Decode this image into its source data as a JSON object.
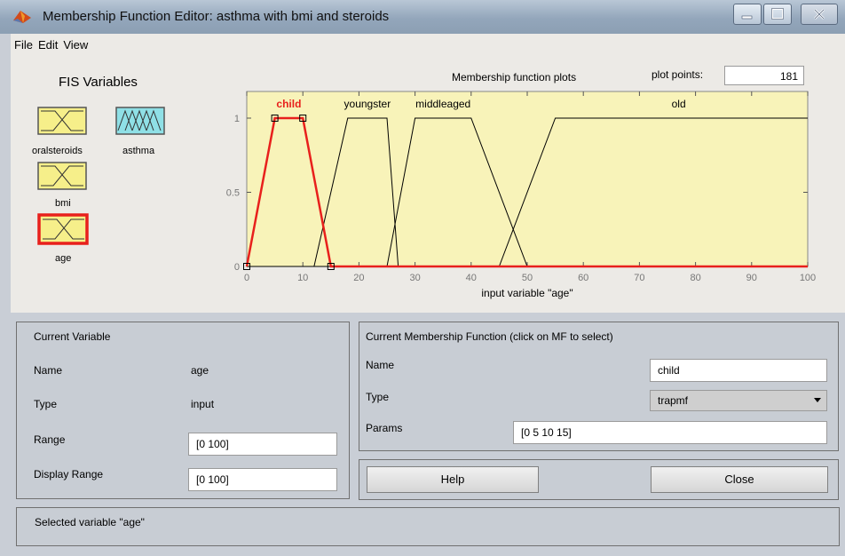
{
  "window": {
    "title": "Membership Function Editor: asthma with bmi and steroids"
  },
  "menu": [
    "File",
    "Edit",
    "View"
  ],
  "fis": {
    "title": "FIS Variables",
    "variables": [
      {
        "name": "oralsteroids",
        "kind": "input",
        "selected": false
      },
      {
        "name": "asthma",
        "kind": "output",
        "selected": false
      },
      {
        "name": "bmi",
        "kind": "input",
        "selected": false
      },
      {
        "name": "age",
        "kind": "input",
        "selected": true
      }
    ]
  },
  "plot": {
    "title": "Membership function plots",
    "plot_points_label": "plot points:",
    "plot_points_value": "181",
    "xlabel": "input variable \"age\"",
    "xticks": [
      "0",
      "10",
      "20",
      "30",
      "40",
      "50",
      "60",
      "70",
      "80",
      "90",
      "100"
    ],
    "yticks": [
      "0",
      "0.5",
      "1"
    ]
  },
  "chart_data": {
    "type": "line",
    "title": "Membership function plots",
    "xlabel": "input variable \"age\"",
    "ylabel": "",
    "xlim": [
      0,
      100
    ],
    "ylim": [
      0,
      1
    ],
    "grid": false,
    "series": [
      {
        "name": "child",
        "x": [
          0,
          5,
          10,
          15
        ],
        "values": [
          0,
          1,
          1,
          0
        ],
        "selected": true
      },
      {
        "name": "youngster",
        "x": [
          12,
          18,
          25,
          27
        ],
        "values": [
          0,
          1,
          1,
          0
        ]
      },
      {
        "name": "middleaged",
        "x": [
          25,
          30,
          40,
          50
        ],
        "values": [
          0,
          1,
          1,
          0
        ]
      },
      {
        "name": "old",
        "x": [
          45,
          55,
          100,
          100
        ],
        "values": [
          0,
          1,
          1,
          1
        ]
      }
    ]
  },
  "current_variable": {
    "title": "Current Variable",
    "name_label": "Name",
    "name_value": "age",
    "type_label": "Type",
    "type_value": "input",
    "range_label": "Range",
    "range_value": "[0 100]",
    "display_range_label": "Display Range",
    "display_range_value": "[0 100]"
  },
  "current_mf": {
    "title": "Current Membership Function (click on MF to select)",
    "name_label": "Name",
    "name_value": "child",
    "type_label": "Type",
    "type_value": "trapmf",
    "params_label": "Params",
    "params_value": "[0 5 10 15]"
  },
  "buttons": {
    "help": "Help",
    "close": "Close"
  },
  "status": "Selected variable \"age\"",
  "colors": {
    "selected": "#e8201c",
    "plot_bg": "#f8f3b9",
    "output_fill": "#8fe0e6",
    "input_fill": "#f6ef8a"
  }
}
